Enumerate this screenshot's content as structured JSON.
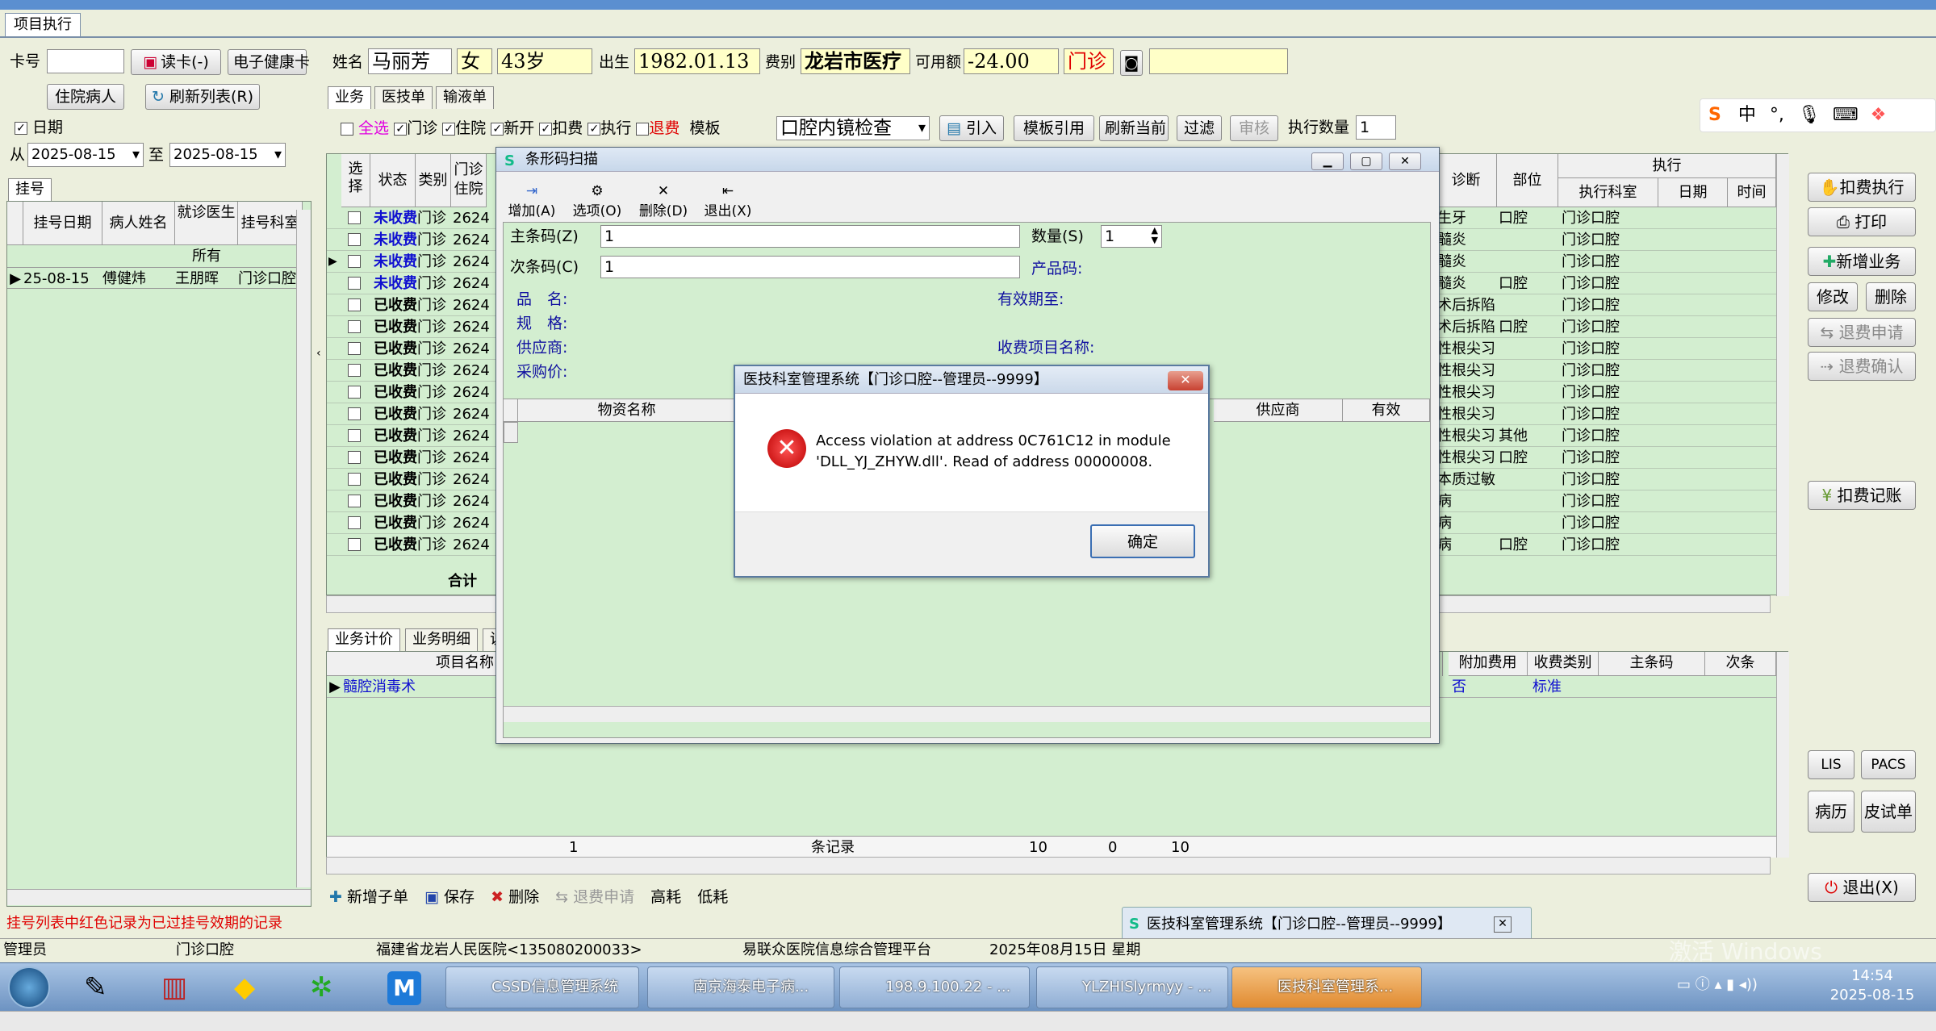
{
  "window": {
    "tab": "项目执行"
  },
  "left": {
    "card_label": "卡号",
    "read_card": "读卡(-)",
    "health_card": "电子健康卡",
    "inpatient": "住院病人",
    "refresh": "刷新列表(R)",
    "date_label": "日期",
    "from_label": "从",
    "from_date": "2025-08-15",
    "to_label": "至",
    "to_date": "2025-08-15",
    "tab": "挂号",
    "columns": [
      "挂号日期",
      "病人姓名",
      "就诊医生",
      "挂号科室"
    ],
    "filter": "所有",
    "rows": [
      [
        "25-08-15",
        "傅健炜",
        "王朋晖",
        "门诊口腔"
      ]
    ]
  },
  "patient": {
    "name_label": "姓名",
    "name": "马丽芳",
    "gender": "女",
    "age": "43岁",
    "birth_label": "出生",
    "birth": "1982.01.13",
    "fee_label": "费别",
    "fee": "龙岩市医疗",
    "balance_label": "可用额",
    "balance": "-24.00",
    "type": "门诊"
  },
  "tabs": [
    "业务",
    "医技单",
    "输液单"
  ],
  "filters": {
    "all": "全选",
    "outpatient": "门诊",
    "inpatient": "住院",
    "new": "新开",
    "deduct": "扣费",
    "execute": "执行",
    "refund": "退费",
    "template_label": "模板",
    "template": "口腔内镜检查",
    "import": "引入",
    "template_ref": "模板引用",
    "refresh_current": "刷新当前",
    "filter": "过滤",
    "audit": "审核",
    "exec_count_label": "执行数量",
    "exec_count": "1"
  },
  "main_grid": {
    "columns": [
      "选择",
      "状态",
      "类别",
      "门诊住院"
    ],
    "right_columns": [
      "诊断",
      "部位",
      "执行科室",
      "日期",
      "时间"
    ],
    "exec_group": "执行",
    "rows": [
      {
        "status": "未收费",
        "type": "门诊",
        "no": "2624",
        "diag": "生牙",
        "part": "口腔",
        "dept": "门诊口腔"
      },
      {
        "status": "未收费",
        "type": "门诊",
        "no": "2624",
        "diag": "髓炎",
        "part": "",
        "dept": "门诊口腔"
      },
      {
        "status": "未收费",
        "type": "门诊",
        "no": "2624",
        "diag": "髓炎",
        "part": "",
        "dept": "门诊口腔"
      },
      {
        "status": "未收费",
        "type": "门诊",
        "no": "2624",
        "diag": "髓炎",
        "part": "口腔",
        "dept": "门诊口腔"
      },
      {
        "status": "已收费",
        "type": "门诊",
        "no": "2624",
        "diag": "术后拆陷",
        "part": "",
        "dept": "门诊口腔"
      },
      {
        "status": "已收费",
        "type": "门诊",
        "no": "2624",
        "diag": "术后拆陷",
        "part": "口腔",
        "dept": "门诊口腔"
      },
      {
        "status": "已收费",
        "type": "门诊",
        "no": "2624",
        "diag": "性根尖习",
        "part": "",
        "dept": "门诊口腔"
      },
      {
        "status": "已收费",
        "type": "门诊",
        "no": "2624",
        "diag": "性根尖习",
        "part": "",
        "dept": "门诊口腔"
      },
      {
        "status": "已收费",
        "type": "门诊",
        "no": "2624",
        "diag": "性根尖习",
        "part": "",
        "dept": "门诊口腔"
      },
      {
        "status": "已收费",
        "type": "门诊",
        "no": "2624",
        "diag": "性根尖习",
        "part": "",
        "dept": "门诊口腔"
      },
      {
        "status": "已收费",
        "type": "门诊",
        "no": "2624",
        "diag": "性根尖习",
        "part": "其他",
        "dept": "门诊口腔"
      },
      {
        "status": "已收费",
        "type": "门诊",
        "no": "2624",
        "diag": "性根尖习",
        "part": "口腔",
        "dept": "门诊口腔"
      },
      {
        "status": "已收费",
        "type": "门诊",
        "no": "2624",
        "diag": "本质过敏",
        "part": "",
        "dept": "门诊口腔"
      },
      {
        "status": "已收费",
        "type": "门诊",
        "no": "2624",
        "diag": "病",
        "part": "",
        "dept": "门诊口腔"
      },
      {
        "status": "已收费",
        "type": "门诊",
        "no": "2624",
        "diag": "病",
        "part": "",
        "dept": "门诊口腔"
      },
      {
        "status": "已收费",
        "type": "门诊",
        "no": "2624",
        "diag": "病",
        "part": "口腔",
        "dept": "门诊口腔"
      }
    ],
    "total_label": "合计"
  },
  "lower": {
    "tabs": [
      "业务计价",
      "业务明细",
      "说"
    ],
    "columns": [
      "项目名称"
    ],
    "right_columns": [
      "附加费用",
      "收费类别",
      "主条码",
      "次条"
    ],
    "row": {
      "name": "髓腔消毒术",
      "extra": "否",
      "fee_type": "标准"
    },
    "footer": {
      "count": "1",
      "records": "条记录",
      "a": "10",
      "b": "0",
      "c": "10"
    },
    "actions": {
      "add_sub": "新增子单",
      "save": "保存",
      "delete": "删除",
      "refund_apply": "退费申请",
      "high": "高耗",
      "low": "低耗"
    }
  },
  "right_buttons": {
    "deduct_exec": "扣费执行",
    "print": "打印",
    "new_business": "新增业务",
    "modify": "修改",
    "delete": "删除",
    "refund_apply": "退费申请",
    "refund_confirm": "退费确认",
    "deduct_record": "扣费记账",
    "lis": "LIS",
    "pacs": "PACS",
    "history": "病历",
    "skin_test": "皮试单",
    "exit": "退出(X)"
  },
  "barcode_dialog": {
    "title": "条形码扫描",
    "tools": {
      "add": "增加(A)",
      "options": "选项(O)",
      "delete": "删除(D)",
      "exit": "退出(X)"
    },
    "main_code_label": "主条码(Z)",
    "main_code": "1",
    "qty_label": "数量(S)",
    "qty": "1",
    "sub_code_label": "次条码(C)",
    "sub_code": "1",
    "product_label": "产品码:",
    "name_label": "品　名:",
    "valid_label": "有效期至:",
    "spec_label": "规　格:",
    "supplier_label": "供应商:",
    "charge_label": "收费项目名称:",
    "price_label": "采购价:",
    "columns": [
      "物资名称",
      "供应商",
      "有效"
    ]
  },
  "error_dialog": {
    "title": "医技科室管理系统【门诊口腔--管理员--9999】",
    "line1": "Access violation at address 0C761C12 in module",
    "line2": "'DLL_YJ_ZHYW.dll'. Read of address 00000008.",
    "ok": "确定"
  },
  "popup": {
    "title": "医技科室管理系统【门诊口腔--管理员--9999】"
  },
  "ime": {
    "zh": "中"
  },
  "status": {
    "hint": "挂号列表中红色记录为已过挂号效期的记录",
    "user": "管理员",
    "dept": "门诊口腔",
    "hospital": "福建省龙岩人民医院<135080200033>",
    "platform": "易联众医院信息综合管理平台",
    "date": "2025年08月15日 星期"
  },
  "taskbar": {
    "items": [
      "CSSD信息管理系统",
      "南京海泰电子病...",
      "198.9.100.22 - ...",
      "YLZHISlyrmyy - ...",
      "医技科室管理系..."
    ],
    "time": "14:54",
    "date": "2025-08-15",
    "watermark": "激活 Windows"
  },
  "colors": {
    "unpaid": "#1010d0",
    "paid": "#000000",
    "grid": "#d3eed0",
    "alert": "#e00000"
  }
}
